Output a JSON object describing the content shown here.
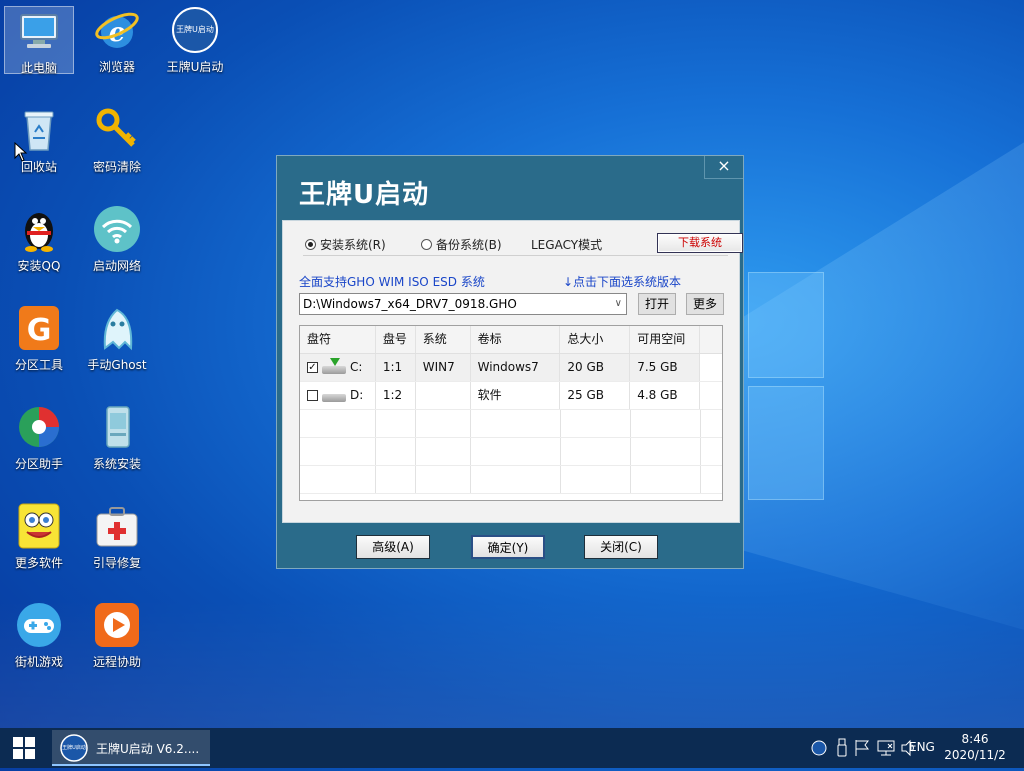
{
  "desktop": {
    "icons": [
      {
        "label": "此电脑"
      },
      {
        "label": "浏览器"
      },
      {
        "label": "王牌U启动"
      },
      {
        "label": "回收站"
      },
      {
        "label": "密码清除"
      },
      {
        "label": "安装QQ"
      },
      {
        "label": "启动网络"
      },
      {
        "label": "分区工具"
      },
      {
        "label": "手动Ghost"
      },
      {
        "label": "分区助手"
      },
      {
        "label": "系统安装"
      },
      {
        "label": "更多软件"
      },
      {
        "label": "引导修复"
      },
      {
        "label": "街机游戏"
      },
      {
        "label": "远程协助"
      }
    ],
    "logo_text": "王牌U启动"
  },
  "dialog": {
    "title": "王牌U启动",
    "close": "×",
    "modes": {
      "install": "安装系统(R)",
      "backup": "备份系统(B)",
      "legacy": "LEGACY模式",
      "selected": "install"
    },
    "download_button": "下载系统",
    "support_text": "全面支持GHO WIM ISO ESD 系统",
    "hint_text": "↓点击下面选系统版本",
    "image_path": "D:\\Windows7_x64_DRV7_0918.GHO",
    "open_button": "打开",
    "more_button": "更多",
    "table": {
      "headers": [
        "盘符",
        "盘号",
        "系统",
        "卷标",
        "总大小",
        "可用空间"
      ],
      "rows": [
        {
          "checked": true,
          "drive": "C:",
          "index": "1:1",
          "os": "WIN7",
          "label": "Windows7",
          "total": "20 GB",
          "free": "7.5 GB"
        },
        {
          "checked": false,
          "drive": "D:",
          "index": "1:2",
          "os": "",
          "label": "软件",
          "total": "25 GB",
          "free": "4.8 GB"
        }
      ]
    },
    "buttons": {
      "advanced": "高级(A)",
      "ok": "确定(Y)",
      "close": "关闭(C)"
    }
  },
  "taskbar": {
    "task_label": "王牌U启动 V6.2....",
    "task_logo": "王牌U启动",
    "lang": "ENG",
    "time": "8:46",
    "date": "2020/11/2"
  },
  "colors": {
    "dialog_bg": "#2a6b8a",
    "link_blue": "#1a46c8",
    "taskbar": "#0c2b52",
    "download_text": "#cc0000"
  }
}
